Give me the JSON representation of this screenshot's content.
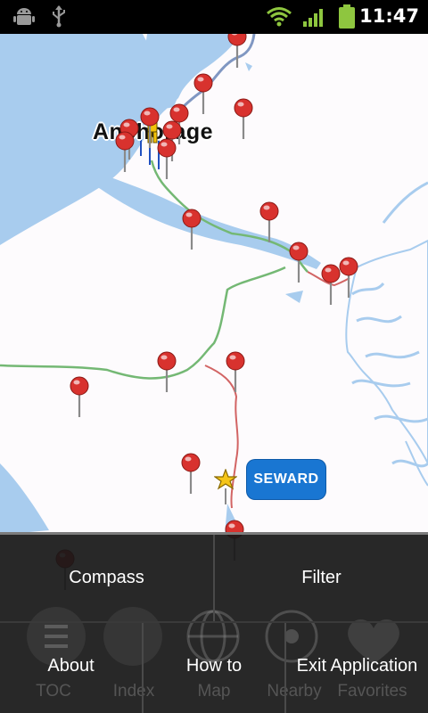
{
  "status_bar": {
    "time": "11:47",
    "icons": [
      "android-debug-icon",
      "usb-icon",
      "wifi-icon",
      "signal-icon",
      "battery-icon"
    ]
  },
  "map": {
    "city_label": "Anchorage",
    "callout_label": "SEWARD",
    "water_color": "#a8ccee",
    "land_color": "#fdfbfd",
    "highway_color": "#74b874",
    "road_color": "#d26464",
    "pin_color": "#d8322e"
  },
  "menu": {
    "items": [
      {
        "label": "Compass"
      },
      {
        "label": "Filter"
      },
      {
        "label": "About"
      },
      {
        "label": "How to"
      },
      {
        "label": "Exit Application"
      }
    ],
    "background_tabs": [
      "TOC",
      "Index",
      "Map",
      "Nearby",
      "Favorites"
    ]
  }
}
